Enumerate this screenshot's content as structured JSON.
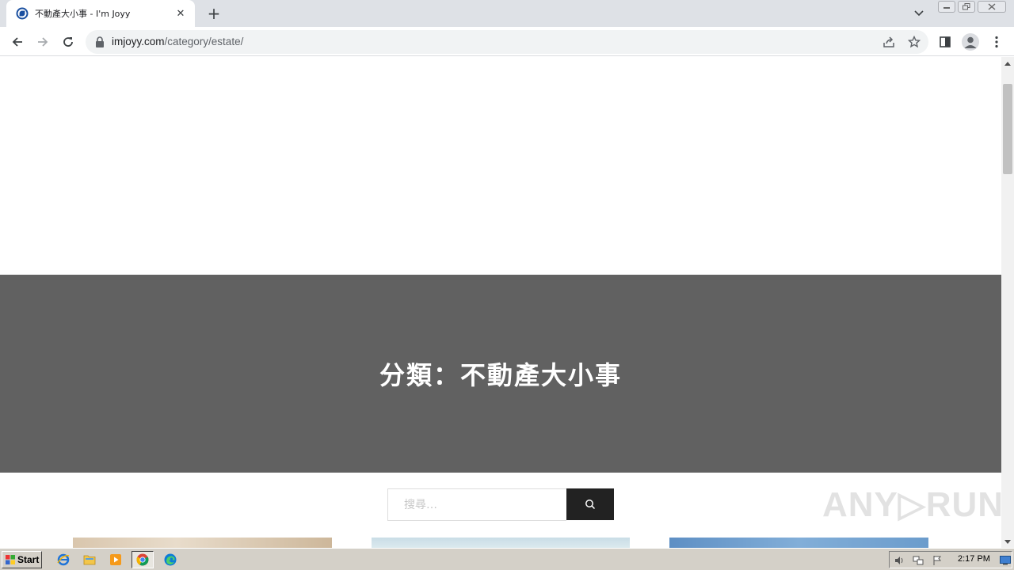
{
  "browser": {
    "tab": {
      "title": "不動產大小事 - I'm Joyy",
      "favicon": "joyy-logo-icon"
    },
    "new_tab_icon": "plus-icon",
    "address": {
      "domain": "imjoyy.com",
      "path": "/category/estate/"
    }
  },
  "page": {
    "hero_title": "分類：不動產大小事",
    "search": {
      "placeholder": "搜尋…",
      "button_icon": "search-icon"
    },
    "watermark": "ANY▷RUN",
    "colors": {
      "hero_bg": "#616161",
      "search_button_bg": "#222222"
    }
  },
  "taskbar": {
    "start_label": "Start",
    "apps": [
      "internet-explorer-icon",
      "folder-icon",
      "media-player-icon",
      "chrome-icon",
      "edge-icon"
    ],
    "clock": "2:17 PM"
  }
}
